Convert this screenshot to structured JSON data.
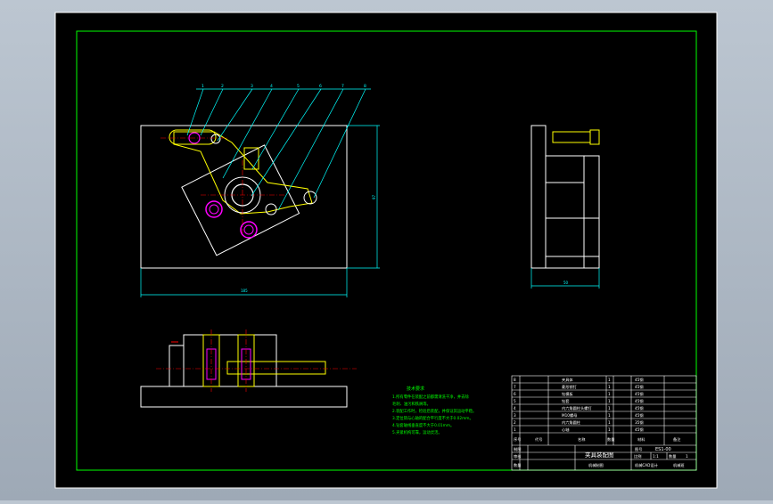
{
  "drawing": {
    "balloons": [
      "1",
      "2",
      "3",
      "4",
      "5",
      "6",
      "7",
      "8"
    ],
    "dim_main_width": "185",
    "dim_main_height": "97",
    "dim_side_width": "50",
    "tech_title": "技术要求",
    "tech_notes": [
      "1.所有零件在装配之前都需清洗干净，并去除",
      "  毛刺、油污和铁屑等。",
      "2.装配工作时，检验后装配，并保证其运动平稳。",
      "3.定位销与心轴的配合平行度不大于0.02mm。",
      "4.钻套轴线垂直度不大于0.01mm。",
      "5.夹紧机构可靠，运动灵活。"
    ]
  },
  "bom": {
    "rows": [
      {
        "no": "8",
        "name": "夹具体",
        "qty": "1",
        "material": "45钢"
      },
      {
        "no": "7",
        "name": "菱形销钉",
        "qty": "1",
        "material": "45钢"
      },
      {
        "no": "6",
        "name": "钻模板",
        "qty": "1",
        "material": "45钢"
      },
      {
        "no": "5",
        "name": "钻套",
        "qty": "1",
        "material": "45钢"
      },
      {
        "no": "4",
        "name": "内六角圆柱头螺钉",
        "qty": "1",
        "material": "45钢"
      },
      {
        "no": "3",
        "name": "M10螺母",
        "qty": "1",
        "material": "45钢"
      },
      {
        "no": "2",
        "name": "内六角圆柱",
        "qty": "1",
        "material": "35钢"
      },
      {
        "no": "1",
        "name": "心轴",
        "qty": "1",
        "material": "45钢"
      }
    ],
    "header": {
      "no": "序号",
      "code": "代号",
      "name": "名称",
      "qty": "数量",
      "material": "材料",
      "remark": "备注"
    }
  },
  "title_block": {
    "drawing_no": "ES1-00",
    "title": "夹具装配图",
    "scale_label": "比例",
    "scale": "1:1",
    "qty_label": "数量",
    "qty": "1",
    "draw_label": "制图",
    "check_label": "审核",
    "dept_label": "数量",
    "drawing_no_label": "图号",
    "footer_center": "机械制图",
    "footer_right_a": "机械CAD设计",
    "footer_right_b": "机械班"
  },
  "colors": {
    "background": "#000000",
    "frame": "#00ff00",
    "geometry": "#ffffff",
    "dimension": "#00ffff",
    "centerline": "#ff0000",
    "highlight": "#ff00ff",
    "hidden": "#ffff00",
    "notes": "#00ff00"
  }
}
